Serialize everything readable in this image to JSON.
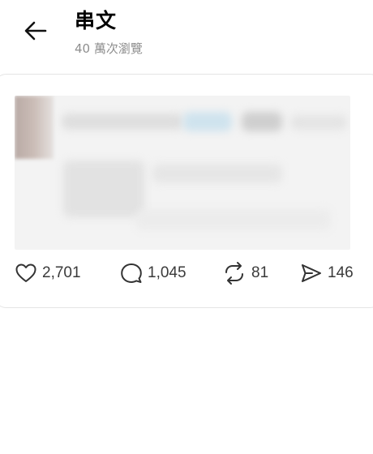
{
  "header": {
    "back_icon": "arrow-left-icon",
    "title": "串文",
    "views": "40 萬次瀏覽"
  },
  "post": {
    "actions": {
      "like": {
        "icon": "heart-icon",
        "count": "2,701"
      },
      "comment": {
        "icon": "comment-icon",
        "count": "1,045"
      },
      "repost": {
        "icon": "repost-icon",
        "count": "81"
      },
      "share": {
        "icon": "send-icon",
        "count": "146"
      }
    }
  }
}
